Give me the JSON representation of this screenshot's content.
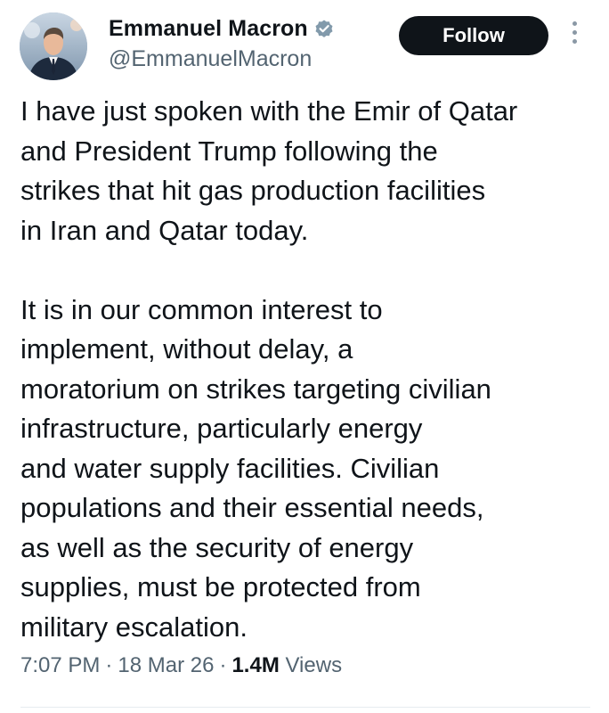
{
  "author": {
    "display_name": "Emmanuel Macron",
    "handle": "@EmmanuelMacron",
    "verified": true,
    "verified_badge_color": "#829aab"
  },
  "actions": {
    "follow_label": "Follow"
  },
  "tweet": {
    "paragraphs": [
      [
        "I have just spoken with the Emir of Qatar",
        "and President Trump following the",
        "strikes that hit gas production facilities",
        "in Iran and Qatar today."
      ],
      [
        "It is in our common interest to",
        "implement, without delay, a",
        "moratorium on strikes targeting civilian",
        "infrastructure, particularly energy",
        "and water supply facilities. Civilian",
        "populations and their essential needs,",
        "as well as the security of energy",
        "supplies, must be protected from",
        "military escalation."
      ]
    ]
  },
  "meta": {
    "time": "7:07 PM",
    "separator": "·",
    "date": "18 Mar 26",
    "views_count": "1.4M",
    "views_label": "Views"
  },
  "colors": {
    "text_primary": "#0f1419",
    "text_secondary": "#536471",
    "follow_bg": "#0f1419",
    "follow_text": "#ffffff"
  },
  "icons": {
    "verified": "verified-badge-icon",
    "more": "more-vertical-icon"
  }
}
